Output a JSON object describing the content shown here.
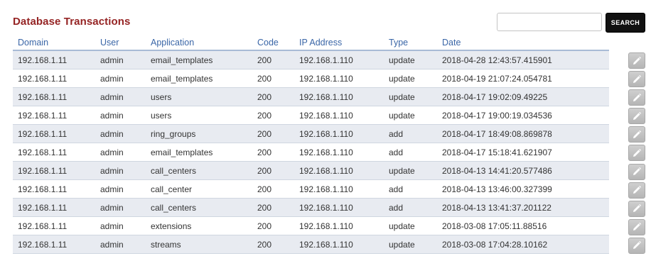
{
  "page": {
    "title": "Database Transactions"
  },
  "search": {
    "value": "",
    "placeholder": "",
    "button_label": "SEARCH"
  },
  "table": {
    "columns": [
      "Domain",
      "User",
      "Application",
      "Code",
      "IP Address",
      "Type",
      "Date"
    ],
    "rows": [
      {
        "domain": "192.168.1.11",
        "user": "admin",
        "application": "email_templates",
        "code": "200",
        "ip": "192.168.1.110",
        "type": "update",
        "date": "2018-04-28 12:43:57.415901"
      },
      {
        "domain": "192.168.1.11",
        "user": "admin",
        "application": "email_templates",
        "code": "200",
        "ip": "192.168.1.110",
        "type": "update",
        "date": "2018-04-19 21:07:24.054781"
      },
      {
        "domain": "192.168.1.11",
        "user": "admin",
        "application": "users",
        "code": "200",
        "ip": "192.168.1.110",
        "type": "update",
        "date": "2018-04-17 19:02:09.49225"
      },
      {
        "domain": "192.168.1.11",
        "user": "admin",
        "application": "users",
        "code": "200",
        "ip": "192.168.1.110",
        "type": "update",
        "date": "2018-04-17 19:00:19.034536"
      },
      {
        "domain": "192.168.1.11",
        "user": "admin",
        "application": "ring_groups",
        "code": "200",
        "ip": "192.168.1.110",
        "type": "add",
        "date": "2018-04-17 18:49:08.869878"
      },
      {
        "domain": "192.168.1.11",
        "user": "admin",
        "application": "email_templates",
        "code": "200",
        "ip": "192.168.1.110",
        "type": "add",
        "date": "2018-04-17 15:18:41.621907"
      },
      {
        "domain": "192.168.1.11",
        "user": "admin",
        "application": "call_centers",
        "code": "200",
        "ip": "192.168.1.110",
        "type": "update",
        "date": "2018-04-13 14:41:20.577486"
      },
      {
        "domain": "192.168.1.11",
        "user": "admin",
        "application": "call_center",
        "code": "200",
        "ip": "192.168.1.110",
        "type": "add",
        "date": "2018-04-13 13:46:00.327399"
      },
      {
        "domain": "192.168.1.11",
        "user": "admin",
        "application": "call_centers",
        "code": "200",
        "ip": "192.168.1.110",
        "type": "add",
        "date": "2018-04-13 13:41:37.201122"
      },
      {
        "domain": "192.168.1.11",
        "user": "admin",
        "application": "extensions",
        "code": "200",
        "ip": "192.168.1.110",
        "type": "update",
        "date": "2018-03-08 17:05:11.88516"
      },
      {
        "domain": "192.168.1.11",
        "user": "admin",
        "application": "streams",
        "code": "200",
        "ip": "192.168.1.110",
        "type": "update",
        "date": "2018-03-08 17:04:28.10162"
      }
    ]
  },
  "icons": {
    "edit": "pencil-icon"
  },
  "colors": {
    "title": "#952424",
    "header_text": "#3a66a7",
    "row_stripe": "#e8ebf1",
    "search_button": "#111111"
  }
}
